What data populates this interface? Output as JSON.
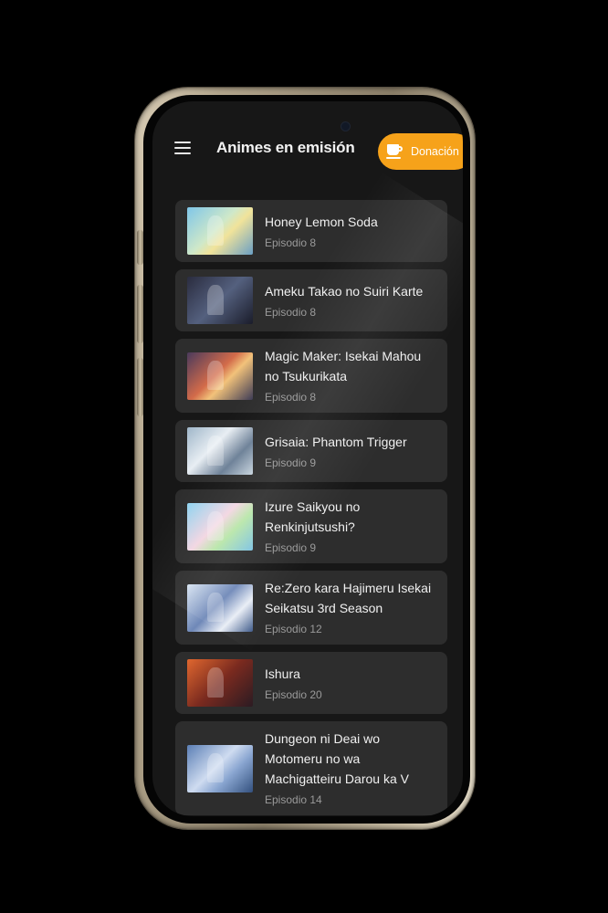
{
  "header": {
    "title": "Animes en emisión",
    "menu_icon": "hamburger-menu-icon",
    "donate_label": "Donación",
    "donate_icon": "coffee-cup-icon",
    "donate_color": "#f6a21a"
  },
  "animes": [
    {
      "title": "Honey Lemon Soda",
      "episode": "Episodio 8"
    },
    {
      "title": "Ameku Takao no Suiri Karte",
      "episode": "Episodio 8"
    },
    {
      "title": "Magic Maker: Isekai Mahou no Tsukurikata",
      "episode": "Episodio 8"
    },
    {
      "title": "Grisaia: Phantom Trigger",
      "episode": "Episodio 9"
    },
    {
      "title": "Izure Saikyou no Renkinjutsushi?",
      "episode": "Episodio 9"
    },
    {
      "title": "Re:Zero kara Hajimeru Isekai Seikatsu 3rd Season",
      "episode": "Episodio 12"
    },
    {
      "title": "Ishura",
      "episode": "Episodio 20"
    },
    {
      "title": "Dungeon ni Deai wo Motomeru no wa Machigatteiru Darou ka V",
      "episode": "Episodio 14"
    }
  ]
}
